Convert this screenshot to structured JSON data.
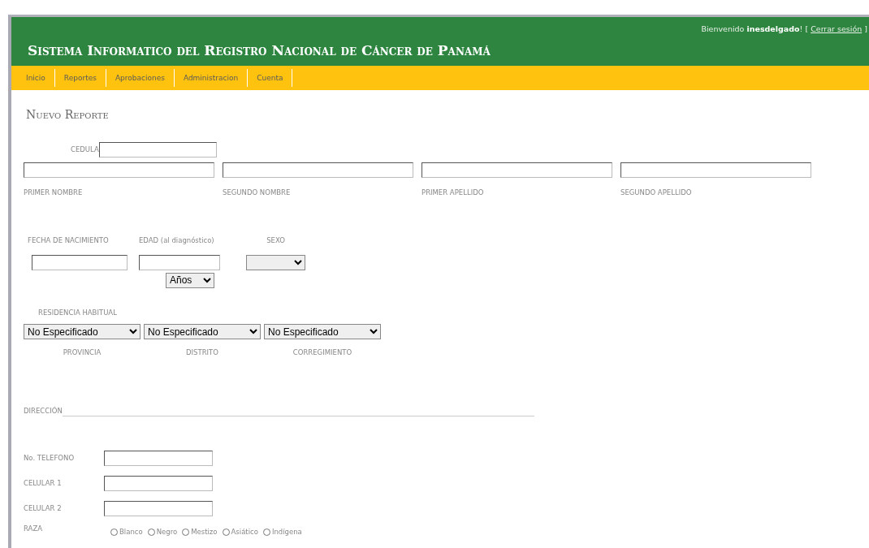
{
  "header": {
    "title": "Sistema Informatico del Registro Nacional de Cáncer de Panamá",
    "welcome": "Bienvenido **inesdelgado**! [",
    "logout_link": "Cerrar sesión",
    "welcome_end": "]"
  },
  "nav": [
    {
      "label": "Inicio"
    },
    {
      "label": "Reportes"
    },
    {
      "label": "Aprobaciones"
    },
    {
      "label": "Administracion"
    },
    {
      "label": "Cuenta"
    }
  ],
  "page_title": "Nuevo Reporte",
  "cedula": {
    "label": "CEDULA"
  },
  "names": [
    {
      "label": "PRIMER NOMBRE"
    },
    {
      "label": "SEGUNDO NOMBRE"
    },
    {
      "label": "PRIMER APELLIDO"
    },
    {
      "label": "SEGUNDO APELLIDO"
    }
  ],
  "birth": {
    "fecha_label": "FECHA DE NACIMIENTO",
    "edad_label": "EDAD (al diagnóstico)",
    "sexo_label": "SEXO",
    "edad_unit": "Años"
  },
  "residence": {
    "label": "RESIDENCIA HABITUAL",
    "selects": [
      {
        "value": "No Especificado",
        "label": "PROVINCIA"
      },
      {
        "value": "No Especificado",
        "label": "DISTRITO"
      },
      {
        "value": "No Especificado",
        "label": "CORREGIMIENTO"
      }
    ]
  },
  "address": {
    "label": "DIRECCIÓN"
  },
  "phones": [
    {
      "label": "No. TELEFONO"
    },
    {
      "label": "CELULAR 1"
    },
    {
      "label": "CELULAR 2"
    }
  ],
  "raza": {
    "label": "RAZA",
    "options": [
      {
        "label": "Blanco",
        "selected": false
      },
      {
        "label": "Negro",
        "selected": false
      },
      {
        "label": "Mestizo",
        "selected": false
      },
      {
        "label": "Asiático",
        "selected": false
      },
      {
        "label": "Indígena",
        "selected": false
      }
    ]
  }
}
